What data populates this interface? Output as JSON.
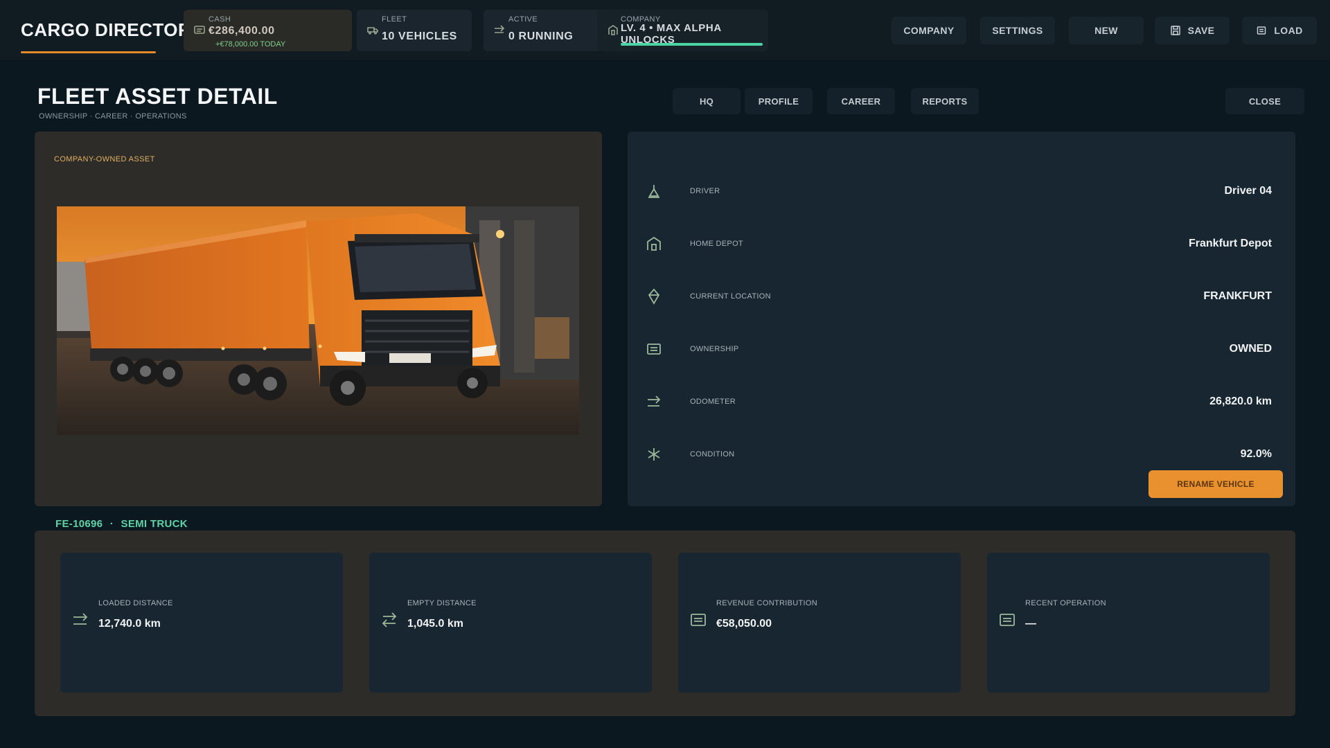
{
  "app": {
    "title": "CARGO DIRECTORATE"
  },
  "stats": {
    "cash": {
      "label": "CASH",
      "value": "€286,400.00",
      "delta": "+€78,000.00 TODAY"
    },
    "fleet": {
      "label": "FLEET",
      "value": "10 VEHICLES"
    },
    "active": {
      "label": "ACTIVE",
      "value": "0 RUNNING"
    },
    "company": {
      "label": "COMPANY",
      "value": "LV. 4 • MAX ALPHA UNLOCKS",
      "progress": 1.0
    }
  },
  "nav": {
    "company": "COMPANY",
    "settings": "SETTINGS",
    "new": "NEW",
    "save": "SAVE",
    "load": "LOAD"
  },
  "page": {
    "title": "FLEET ASSET DETAIL",
    "subtitle": "OWNERSHIP · CAREER · OPERATIONS"
  },
  "tabs": [
    "HQ",
    "PROFILE",
    "CAREER",
    "REPORTS"
  ],
  "close_label": "CLOSE",
  "asset": {
    "tag": "COMPANY-OWNED ASSET",
    "id": "FE-10696",
    "separator": "·",
    "type": "SEMI TRUCK"
  },
  "details": [
    {
      "icon": "driver-icon",
      "label": "DRIVER",
      "value": "Driver 04"
    },
    {
      "icon": "depot-icon",
      "label": "HOME DEPOT",
      "value": "Frankfurt Depot"
    },
    {
      "icon": "location-pin-icon",
      "label": "CURRENT LOCATION",
      "value": "FRANKFURT"
    },
    {
      "icon": "document-icon",
      "label": "OWNERSHIP",
      "value": "OWNED"
    },
    {
      "icon": "arrow-right-icon",
      "label": "ODOMETER",
      "value": "26,820.0 km"
    },
    {
      "icon": "wrench-cross-icon",
      "label": "CONDITION",
      "value": "92.0%"
    }
  ],
  "rename_label": "RENAME VEHICLE",
  "metrics": [
    {
      "icon": "arrow-right-icon",
      "label": "LOADED DISTANCE",
      "value": "12,740.0 km"
    },
    {
      "icon": "swap-arrows-icon",
      "label": "EMPTY DISTANCE",
      "value": "1,045.0 km"
    },
    {
      "icon": "document-icon",
      "label": "REVENUE CONTRIBUTION",
      "value": "€58,050.00"
    },
    {
      "icon": "document-icon",
      "label": "RECENT OPERATION",
      "value": "—"
    }
  ],
  "colors": {
    "accent": "#e8912e",
    "positive": "#7ed08a",
    "teal": "#5fd3a6",
    "background": "#0c1820",
    "panel": "#172630",
    "panel_warm": "#2d2c28"
  }
}
